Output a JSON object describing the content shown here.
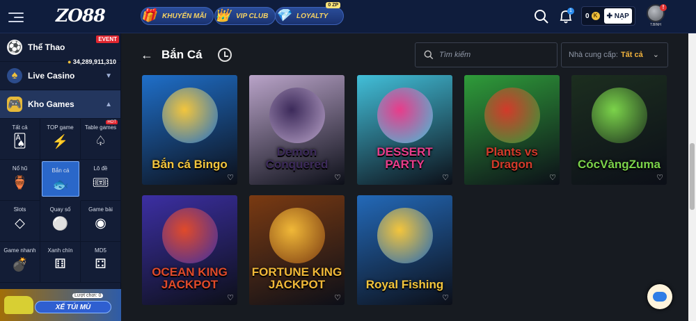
{
  "header": {
    "logo": "ZO88",
    "pills": [
      {
        "label": "KHUYẾN MÃI",
        "icon": "gift-box-icon"
      },
      {
        "label": "VIP CLUB",
        "icon": "crown-icon"
      },
      {
        "label": "LOYALTY",
        "icon": "diamond-icon",
        "badge": "0 ZP"
      }
    ],
    "notification_count": "1",
    "balance": "0",
    "balance_unit": "K",
    "deposit_label": "NẠP",
    "username": "T.BINH",
    "alert": "!"
  },
  "sidebar": {
    "items": [
      {
        "label": "Thể Thao",
        "icon": "soccer-ball-icon",
        "badge": "EVENT"
      },
      {
        "label": "Live Casino",
        "icon": "spade-icon",
        "jackpot": "34,289,911,310"
      },
      {
        "label": "Kho Games",
        "icon": "gamepad-icon"
      }
    ],
    "games": [
      {
        "label": "Tất cả",
        "icon": "cards-icon"
      },
      {
        "label": "TOP game",
        "icon": "lightning-icon"
      },
      {
        "label": "Table games",
        "icon": "table-cards-icon",
        "badge": "HOT"
      },
      {
        "label": "Nổ hũ",
        "icon": "pot-icon"
      },
      {
        "label": "Bắn cá",
        "icon": "fish-icon"
      },
      {
        "label": "Lô đề",
        "icon": "ticket-icon"
      },
      {
        "label": "Slots",
        "icon": "diamond-icon"
      },
      {
        "label": "Quay số",
        "icon": "lottery-ball-icon"
      },
      {
        "label": "Game bài",
        "icon": "chip-icon"
      },
      {
        "label": "Game nhanh",
        "icon": "bomb-icon"
      },
      {
        "label": "Xanh chín",
        "icon": "dice-icon"
      },
      {
        "label": "MD5",
        "icon": "dice-pair-icon"
      }
    ],
    "promo": {
      "label": "XẾ TÚI MÙ",
      "tag": "Lượt chơi: 0"
    }
  },
  "main": {
    "title": "Bắn Cá",
    "search_placeholder": "Tìm kiếm",
    "provider_label": "Nhà cung cấp:",
    "provider_value": "Tất cả"
  },
  "games": [
    {
      "title": "Bắn cá Bingo",
      "bg": "#1f6fc9",
      "accent": "#f2c53d"
    },
    {
      "title": "Demon Conquered",
      "bg": "#b9a3c8",
      "accent": "#3c2a5a"
    },
    {
      "title": "DESSERT PARTY",
      "bg": "#42bfd9",
      "accent": "#e83c8a"
    },
    {
      "title": "Plants vs Dragon",
      "bg": "#2f9c3a",
      "accent": "#d23a2a"
    },
    {
      "title": "CócVàngZuma",
      "bg": "#1c2e1f",
      "accent": "#7bd34a"
    },
    {
      "title": "OCEAN KING JACKPOT",
      "bg": "#3c2fa3",
      "accent": "#e04a2a"
    },
    {
      "title": "FORTUNE KING JACKPOT",
      "bg": "#7a3a12",
      "accent": "#f0b838"
    },
    {
      "title": "Royal Fishing",
      "bg": "#2369b8",
      "accent": "#f3c53c"
    }
  ]
}
